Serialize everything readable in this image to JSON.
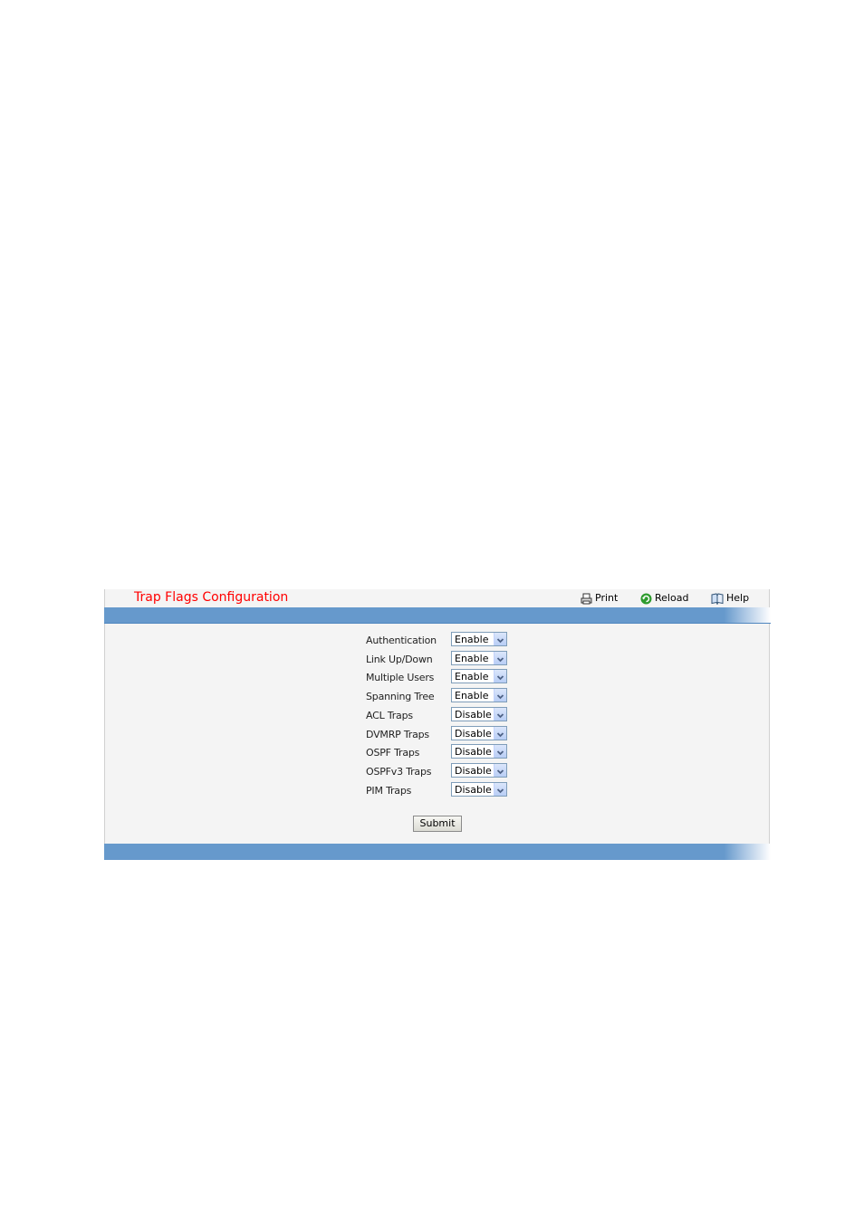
{
  "header": {
    "title": "Trap Flags Configuration",
    "toolbar": {
      "print": {
        "label": "Print",
        "icon": "printer-icon"
      },
      "reload": {
        "label": "Reload",
        "icon": "reload-icon"
      },
      "help": {
        "label": "Help",
        "icon": "book-icon"
      }
    }
  },
  "form": {
    "rows": [
      {
        "label": "Authentication",
        "value": "Enable"
      },
      {
        "label": "Link Up/Down",
        "value": "Enable"
      },
      {
        "label": "Multiple Users",
        "value": "Enable"
      },
      {
        "label": "Spanning Tree",
        "value": "Enable"
      },
      {
        "label": "ACL Traps",
        "value": "Disable"
      },
      {
        "label": "DVMRP Traps",
        "value": "Disable"
      },
      {
        "label": "OSPF Traps",
        "value": "Disable"
      },
      {
        "label": "OSPFv3 Traps",
        "value": "Disable"
      },
      {
        "label": "PIM Traps",
        "value": "Disable"
      }
    ],
    "submit_label": "Submit"
  },
  "colors": {
    "title": "#ff0000",
    "bar": "#6699cc",
    "panel_bg": "#f4f4f4"
  }
}
